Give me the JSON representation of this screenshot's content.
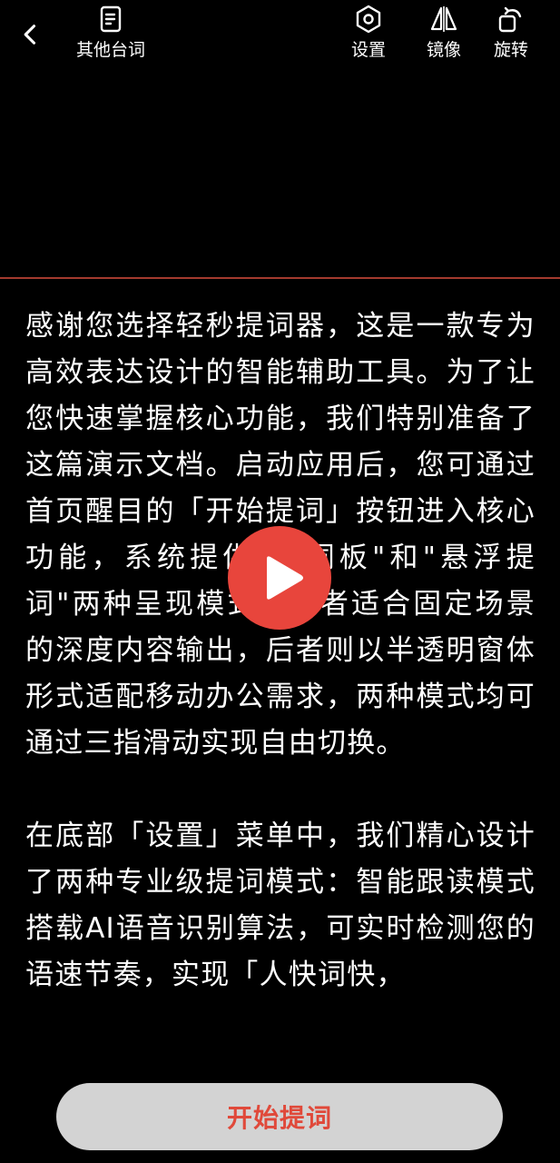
{
  "toolbar": {
    "back_icon": "chevron-left-icon",
    "script_label": "其他台词",
    "settings_label": "设置",
    "mirror_label": "镜像",
    "rotate_label": "旋转"
  },
  "colors": {
    "accent": "#e8453c",
    "divider": "#a33a2e",
    "start_text": "#e0493a",
    "start_bg": "#d3d3d3"
  },
  "script": {
    "paragraphs": [
      "感谢您选择轻秒提词器，这是一款专为高效表达设计的智能辅助工具。为了让您快速掌握核心功能，我们特别准备了这篇演示文档。启动应用后，您可通过首页醒目的「开始提词」按钮进入核心功能，系统提供\"提词板\"和\"悬浮提词\"两种呈现模式：前者适合固定场景的深度内容输出，后者则以半透明窗体形式适配移动办公需求，两种模式均可通过三指滑动实现自由切换。",
      "在底部「设置」菜单中，我们精心设计了两种专业级提词模式：智能跟读模式搭载AI语音识别算法，可实时检测您的语速节奏，实现「人快词快，"
    ]
  },
  "play": {
    "icon": "play-icon"
  },
  "bottom": {
    "start_label": "开始提词"
  }
}
